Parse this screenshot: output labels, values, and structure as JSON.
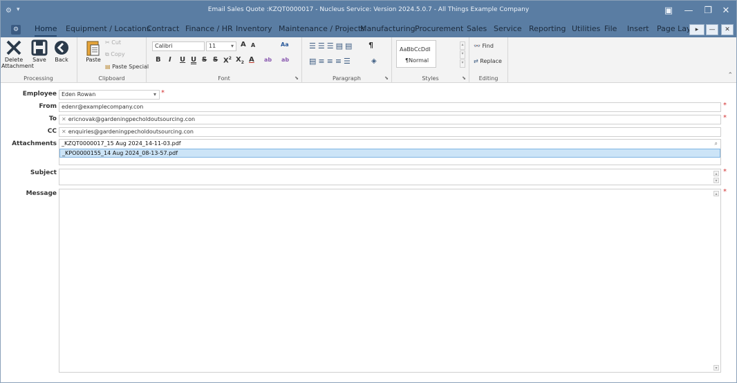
{
  "window": {
    "title": "Email Sales Quote :KZQT0000017 - Nucleus Service: Version 2024.5.0.7 - All Things Example Company",
    "minimize": "—",
    "maximize": "❐",
    "close": "✕",
    "options_icon": "▣"
  },
  "ribbon_tabs": [
    "Home",
    "Equipment / Locations",
    "Contract",
    "Finance / HR",
    "Inventory",
    "Maintenance / Projects",
    "Manufacturing",
    "Procurement",
    "Sales",
    "Service",
    "Reporting",
    "Utilities",
    "File",
    "Insert",
    "Page Layo"
  ],
  "ribbon_overflow": {
    "arrow": "▸",
    "minimize": "—",
    "close": "✕"
  },
  "processing": {
    "delete_label": "Delete Attachment",
    "save_label": "Save",
    "back_label": "Back",
    "group_label": "Processing"
  },
  "clipboard": {
    "paste_label": "Paste",
    "cut_label": "Cut",
    "copy_label": "Copy",
    "paste_special_label": "Paste Special",
    "group_label": "Clipboard"
  },
  "font": {
    "family": "Calibri",
    "size": "11",
    "grow": "A",
    "shrink": "A",
    "case": "Aa",
    "bold": "B",
    "italic": "I",
    "underline": "U",
    "double_underline": "U",
    "strike": "S",
    "double_strike": "S",
    "superscript": "X",
    "subscript": "X",
    "font_color": "A",
    "highlight": "ab",
    "clear": "ab",
    "group_label": "Font"
  },
  "paragraph": {
    "group_label": "Paragraph",
    "pilcrow": "¶"
  },
  "styles": {
    "sample1": "AaBbCcDdI",
    "sample2": "¶Normal",
    "group_label": "Styles"
  },
  "editing": {
    "find_label": "Find",
    "replace_label": "Replace",
    "group_label": "Editing"
  },
  "form": {
    "employee_label": "Employee",
    "employee_value": "Eden Rowan",
    "from_label": "From",
    "from_value": "edenr@examplecompany.con",
    "to_label": "To",
    "to_value": "ericnovak@gardeningpecholdoutsourcing.con",
    "cc_label": "CC",
    "cc_value": "enquiries@gardeningpecholdoutsourcing.con",
    "attachments_label": "Attachments",
    "attachments": [
      "_KZQT0000017_15 Aug 2024_14-11-03.pdf",
      "_KPO0000155_14 Aug 2024_08-13-57.pdf"
    ],
    "subject_label": "Subject",
    "subject_value": "",
    "message_label": "Message",
    "message_value": "",
    "required_mark": "*",
    "chip_x": "✕"
  },
  "colors": {
    "titlebar": "#5a7da3",
    "ribbon": "#f3f3f3",
    "selected_row": "#cce4f7",
    "required": "#d23030"
  }
}
